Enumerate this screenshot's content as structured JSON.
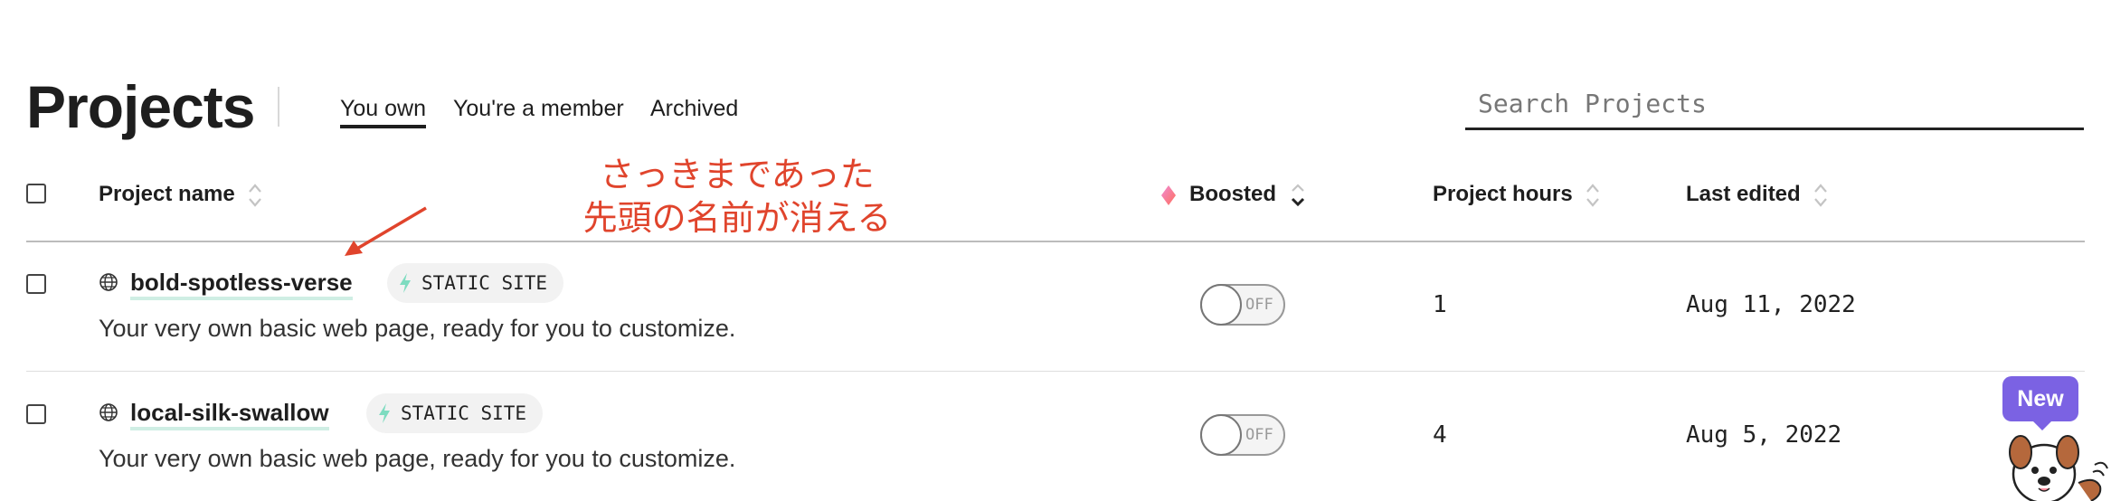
{
  "header": {
    "title": "Projects",
    "tabs": [
      {
        "label": "You own",
        "active": true
      },
      {
        "label": "You're a member",
        "active": false
      },
      {
        "label": "Archived",
        "active": false
      }
    ],
    "search_placeholder": "Search Projects"
  },
  "table": {
    "columns": {
      "name": "Project name",
      "boosted": "Boosted",
      "hours": "Project hours",
      "edited": "Last edited"
    },
    "rows": [
      {
        "name": "bold-spotless-verse",
        "badge": "STATIC SITE",
        "description": "Your very own basic web page, ready for you to customize.",
        "boosted": "OFF",
        "hours": "1",
        "last_edited": "Aug 11, 2022"
      },
      {
        "name": "local-silk-swallow",
        "badge": "STATIC SITE",
        "description": "Your very own basic web page, ready for you to customize.",
        "boosted": "OFF",
        "hours": "4",
        "last_edited": "Aug 5, 2022"
      }
    ]
  },
  "annotation": {
    "line1": "さっきまであった",
    "line2": "先頭の名前が消える",
    "color": "#e0442c"
  },
  "new_badge": "New",
  "colors": {
    "accent_purple": "#7b62e3",
    "underline_mint": "#cfeee4",
    "bolt_green": "#7ddcc0",
    "text_dark": "#1e1e1e"
  }
}
